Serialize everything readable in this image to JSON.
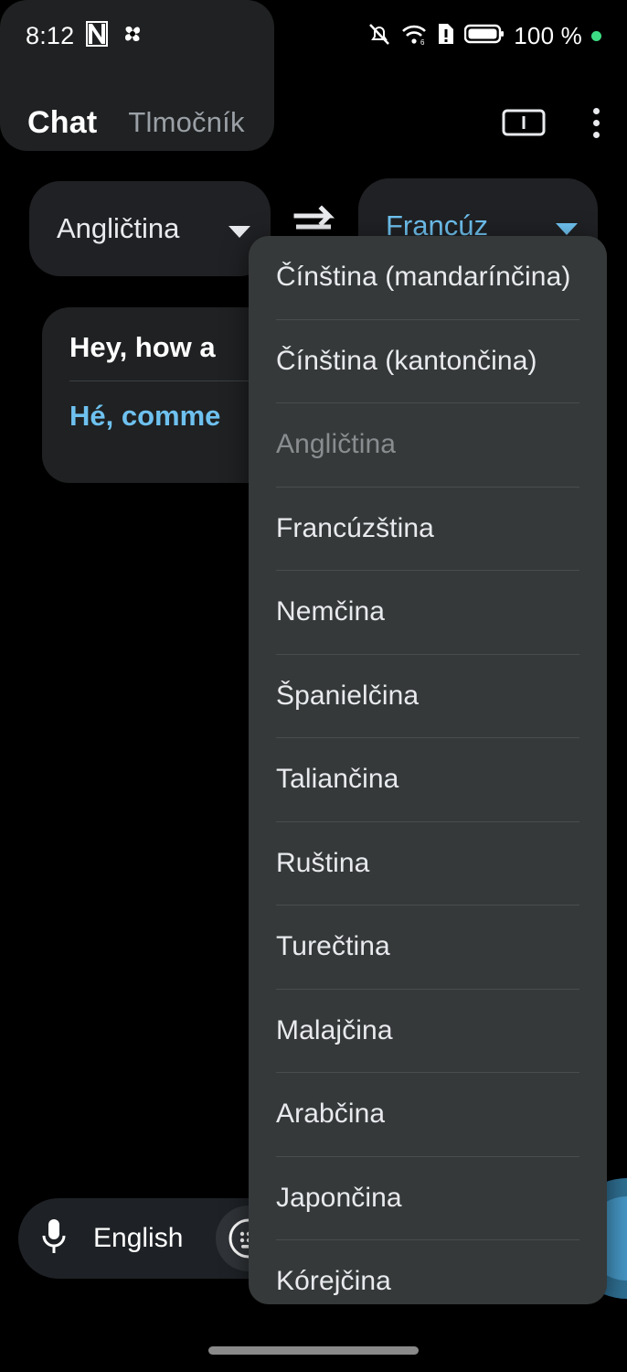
{
  "status_bar": {
    "time": "8:12",
    "battery_percent": "100 %",
    "icons": [
      "nfc-icon",
      "pinwheel-icon",
      "mute-bell-icon",
      "wifi-6-icon",
      "sim-alert-icon",
      "battery-full-icon",
      "green-dot-indicator"
    ]
  },
  "appbar": {
    "tab_active": "Chat",
    "tab_inactive": "Tlmočník",
    "transcribe_icon": "transcribe-icon",
    "overflow_icon": "more-vertical-icon"
  },
  "language_selector": {
    "source_label": "Angličtina",
    "target_label": "Francúz",
    "swap_icon": "swap-horizontal-icon",
    "caret_icon": "chevron-down-icon",
    "accent_color": "#6ec1ef"
  },
  "conversation": {
    "bubbles": [
      {
        "source_text": "Hey, how a",
        "translated_text": "Hé, comme"
      },
      {
        "source_text": "",
        "translated_text": ""
      }
    ]
  },
  "bottom_bar": {
    "mic_icon": "microphone-icon",
    "language": "English",
    "keyboard_icon": "keyboard-icon",
    "fab_icon": "mic-fab-button"
  },
  "language_menu": {
    "items": [
      {
        "label": "Čínština (mandarínčina)",
        "disabled": false
      },
      {
        "label": "Čínština (kantončina)",
        "disabled": false
      },
      {
        "label": "Angličtina",
        "disabled": true
      },
      {
        "label": "Francúzština",
        "disabled": false
      },
      {
        "label": "Nemčina",
        "disabled": false
      },
      {
        "label": "Španielčina",
        "disabled": false
      },
      {
        "label": "Taliančina",
        "disabled": false
      },
      {
        "label": "Ruština",
        "disabled": false
      },
      {
        "label": "Turečtina",
        "disabled": false
      },
      {
        "label": "Malajčina",
        "disabled": false
      },
      {
        "label": "Arabčina",
        "disabled": false
      },
      {
        "label": "Japončina",
        "disabled": false
      },
      {
        "label": "Kórejčina",
        "disabled": false
      }
    ]
  },
  "navigation": {
    "home_indicator": "home-indicator"
  }
}
